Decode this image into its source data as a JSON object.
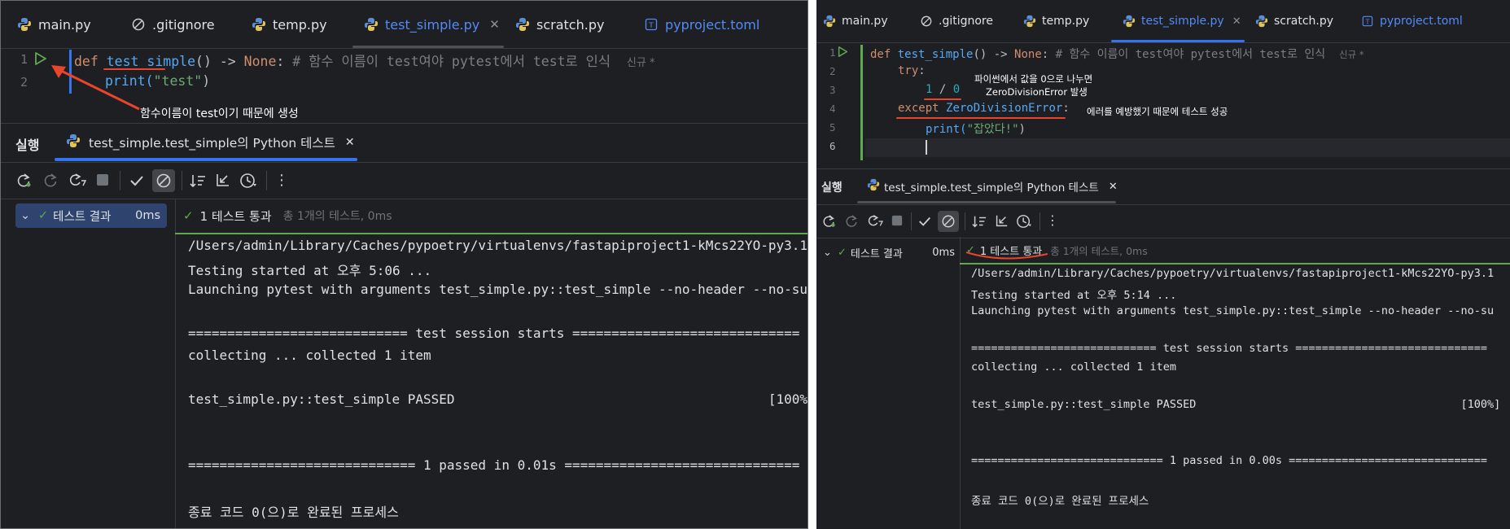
{
  "left": {
    "tabs": [
      {
        "icon": "python-icon",
        "label": "main.py"
      },
      {
        "icon": "ignore-file-icon",
        "label": ".gitignore"
      },
      {
        "icon": "python-icon",
        "label": "temp.py"
      },
      {
        "icon": "python-icon",
        "label": "test_simple.py",
        "active": true,
        "closable": true
      },
      {
        "icon": "python-icon",
        "label": "scratch.py"
      },
      {
        "icon": "toml-file-icon",
        "label": "pyproject.toml"
      }
    ],
    "editor": {
      "line_numbers": [
        "1",
        "2"
      ],
      "line1": {
        "def": "def",
        "name": "test_simple",
        "rest": "() -> ",
        "none": "None",
        "colon": ": ",
        "comment": "# 함수 이름이 test여야 pytest에서 test로 인식",
        "hint": "신규 *"
      },
      "line2": {
        "print": "print(",
        "str": "\"test\"",
        "close": ")"
      },
      "annotation": "함수이름이 test이기 때문에 생성"
    },
    "run": {
      "label": "실행",
      "tab": "test_simple.test_simple의 Python 테스트"
    },
    "tree": {
      "label": "테스트 결과",
      "time": "0ms"
    },
    "status": {
      "main": "1 테스트 통과",
      "sub": "총 1개의 테스트, 0ms"
    },
    "console": [
      "/Users/admin/Library/Caches/pypoetry/virtualenvs/fastapiproject1-kMcs22YO-py3.1",
      "Testing started at 오후 5:06 ...",
      "Launching pytest with arguments test_simple.py::test_simple --no-header --no-su",
      "",
      "============================ test session starts =============================",
      "collecting ... collected 1 item",
      "",
      "test_simple.py::test_simple PASSED                                        [100%]",
      "",
      "",
      "============================= 1 passed in 0.01s ==============================",
      "",
      "종료 코드 0(으)로 완료된 프로세스"
    ]
  },
  "right": {
    "tabs": [
      {
        "icon": "python-icon",
        "label": "main.py"
      },
      {
        "icon": "ignore-file-icon",
        "label": ".gitignore"
      },
      {
        "icon": "python-icon",
        "label": "temp.py"
      },
      {
        "icon": "python-icon",
        "label": "test_simple.py",
        "active": true,
        "closable": true
      },
      {
        "icon": "python-icon",
        "label": "scratch.py"
      },
      {
        "icon": "toml-file-icon",
        "label": "pyproject.toml"
      }
    ],
    "editor": {
      "line_numbers": [
        "1",
        "2",
        "3",
        "4",
        "5",
        "6"
      ],
      "line1": {
        "def": "def",
        "name": "test_simple",
        "rest": "() -> ",
        "none": "None",
        "colon": ": ",
        "comment": "# 함수 이름이 test여야 pytest에서 test로 인식",
        "hint": "신규 *"
      },
      "line2": {
        "try": "try",
        "colon": ":"
      },
      "line3": {
        "a": "1",
        "op": " / ",
        "b": "0"
      },
      "line4": {
        "except": "except",
        "exc": "ZeroDivisionError",
        "colon": ":"
      },
      "line5": {
        "print": "print(",
        "str": "\"잡았다!\"",
        "close": ")"
      },
      "annotation_1a": "파이썬에서 값을 0으로 나누면",
      "annotation_1b": "ZeroDivisionError 발생",
      "annotation_2": "에러를 예방했기 때문에 테스트 성공"
    },
    "run": {
      "label": "실행",
      "tab": "test_simple.test_simple의 Python 테스트"
    },
    "tree": {
      "label": "테스트 결과",
      "time": "0ms"
    },
    "status": {
      "main": "1 테스트 통과",
      "sub": "총 1개의 테스트, 0ms"
    },
    "console": [
      "/Users/admin/Library/Caches/pypoetry/virtualenvs/fastapiproject1-kMcs22YO-py3.1",
      "Testing started at 오후 5:14 ...",
      "Launching pytest with arguments test_simple.py::test_simple --no-header --no-su",
      "",
      "============================ test session starts =============================",
      "collecting ... collected 1 item",
      "",
      "test_simple.py::test_simple PASSED                                        [100%]",
      "",
      "",
      "============================= 1 passed in 0.00s ==============================",
      "",
      "종료 코드 0(으)로 완료된 프로세스"
    ]
  },
  "colors": {
    "background": "#1e1f22",
    "accent": "#3574f0",
    "keyword": "#cf8e6d",
    "function": "#56a8f5",
    "string": "#6aab73",
    "pass": "#5fa94f",
    "annotation_red": "#e8452c"
  }
}
